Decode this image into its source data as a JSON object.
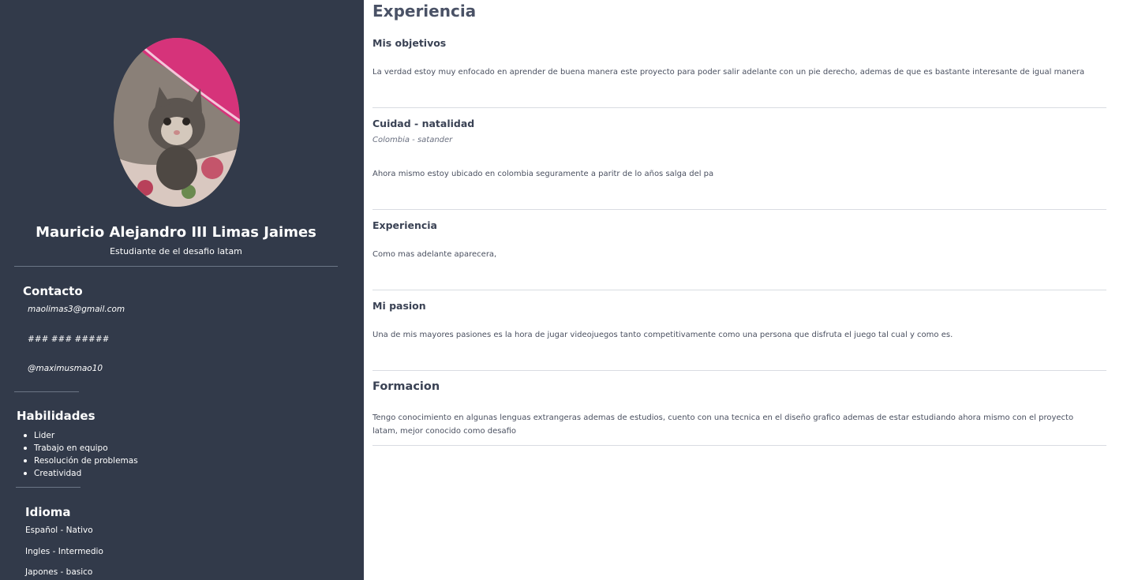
{
  "profile": {
    "name": "Mauricio Alejandro III Limas Jaimes",
    "role": "Estudiante de el desafio latam"
  },
  "contact": {
    "title": "Contacto",
    "email": "maolimas3@gmail.com",
    "phone": "### ### #####",
    "handle": "@maximusmao10"
  },
  "skills": {
    "title": "Habilidades",
    "items": [
      "Lider",
      "Trabajo en equipo",
      "Resolución de problemas",
      "Creatividad"
    ]
  },
  "languages": {
    "title": "Idioma",
    "items": [
      "Español - Nativo",
      "Ingles - Intermedio",
      "Japones - basico"
    ]
  },
  "main": {
    "title": "Experiencia",
    "sections": [
      {
        "title": "Mis objetivos",
        "text": "La verdad estoy muy enfocado en aprender de buena manera este proyecto para poder salir adelante con un pie derecho, ademas de que es bastante interesante de igual manera"
      },
      {
        "title": "Cuidad - natalidad",
        "subtitle": "Colombia - satander",
        "text": "Ahora mismo estoy ubicado en colombia seguramente a paritr de lo años salga del pa"
      },
      {
        "title": "Experiencia",
        "text": "Como mas adelante aparecera,"
      },
      {
        "title": "Mi pasion",
        "text": "Una de mis mayores pasiones es la hora de jugar videojuegos tanto competitivamente como una persona que disfruta el juego tal cual y como es."
      },
      {
        "title": "Formacion",
        "text": "Tengo conocimiento en algunas lenguas extrangeras ademas de estudios, cuento con una tecnica en el diseño grafico ademas de estar estudiando ahora mismo con el proyecto latam, mejor conocido como desafio"
      }
    ]
  },
  "colors": {
    "sidebar_bg": "#323a4a",
    "heading_text": "#4a5266",
    "avatar_accent": "#d6337a"
  }
}
